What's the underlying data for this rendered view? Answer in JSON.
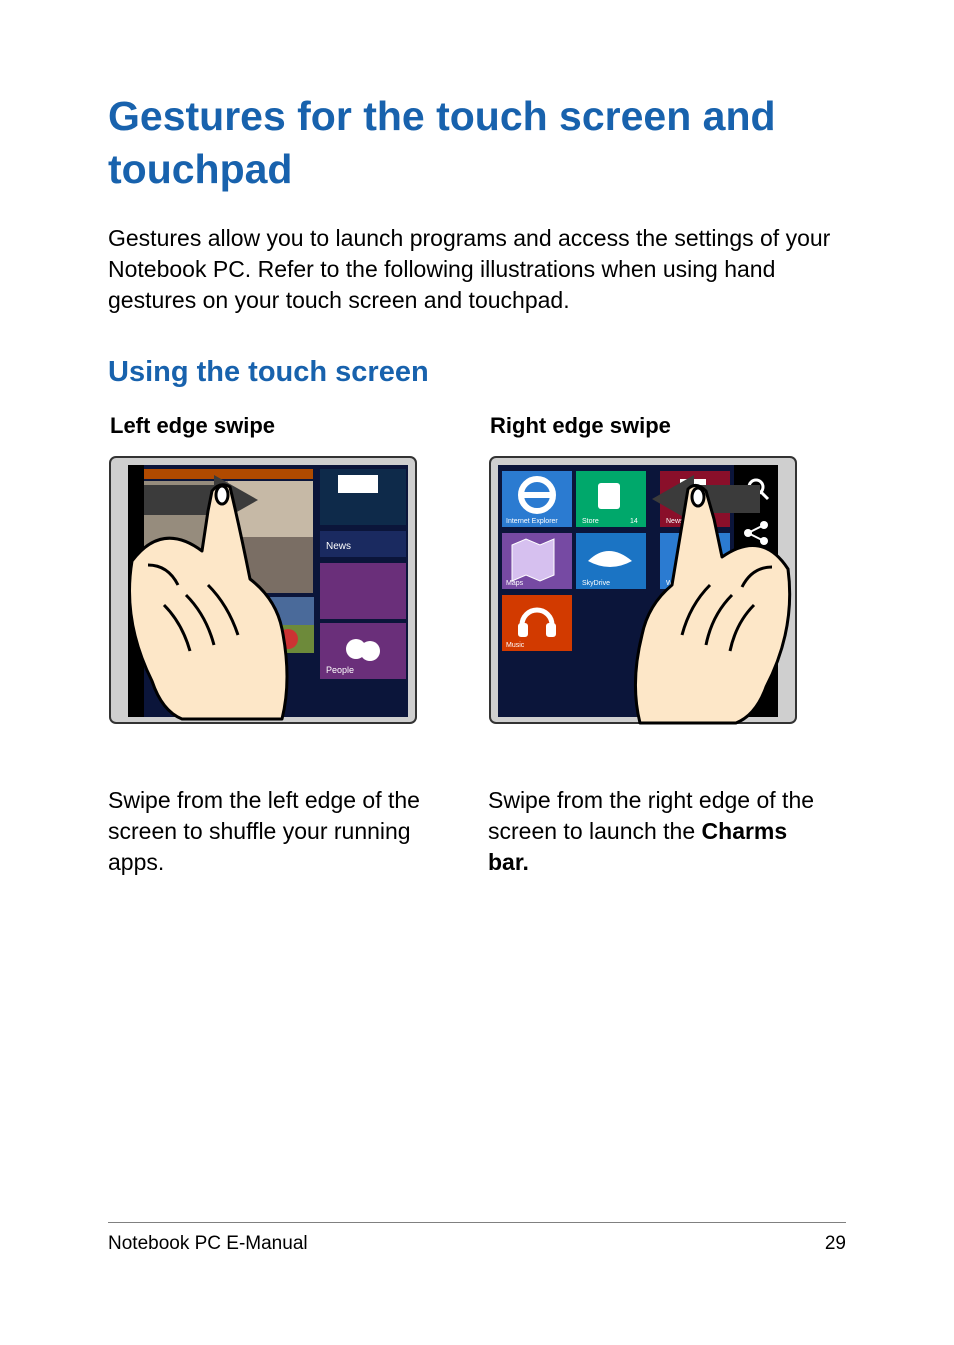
{
  "title": "Gestures for the touch screen and touchpad",
  "intro": "Gestures allow you to launch programs and access the settings of your Notebook PC. Refer to the following illustrations when using hand gestures on your touch screen and touchpad.",
  "section": "Using the touch screen",
  "left": {
    "heading": "Left edge swipe",
    "desc": "Swipe from the left edge of the screen to shuffle your running apps."
  },
  "right": {
    "heading": "Right edge swipe",
    "desc_pre": "Swipe from the right edge of the screen to launch the ",
    "desc_bold": "Charms bar."
  },
  "footer": {
    "doc": "Notebook PC E-Manual",
    "page": "29"
  }
}
